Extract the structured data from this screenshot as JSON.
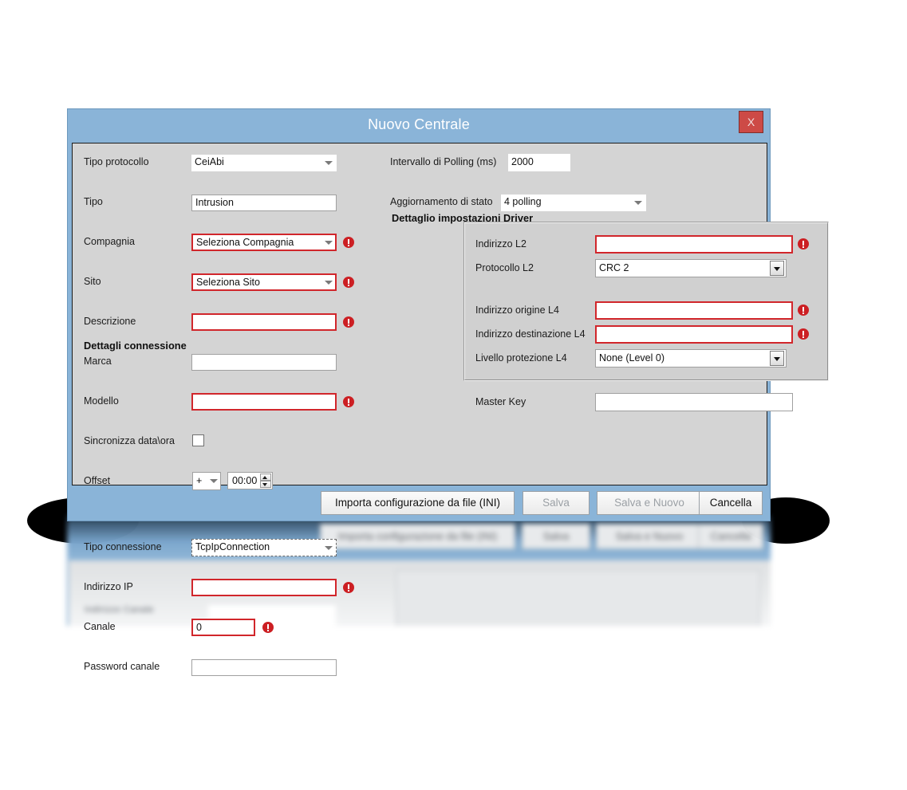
{
  "dialog": {
    "title": "Nuovo Centrale",
    "close_label": "X",
    "accent_blue": "#8ab4d8",
    "close_red": "#cd4a46",
    "error_red": "#cc1f23"
  },
  "left_column": {
    "rows": [
      {
        "label": "Tipo protocollo",
        "value": "CeiAbi",
        "control": "combo-flat",
        "error": false
      },
      {
        "label": "Tipo",
        "value": "Intrusion",
        "control": "textbox",
        "error": false
      },
      {
        "label": "Compagnia",
        "value": "Seleziona Compagnia",
        "control": "combo-flat",
        "error": true
      },
      {
        "label": "Sito",
        "value": "Seleziona Sito",
        "control": "combo-flat",
        "error": true
      },
      {
        "label": "Descrizione",
        "value": "",
        "control": "textbox",
        "error": true
      },
      {
        "label": "Marca",
        "value": "",
        "control": "textbox",
        "error": false
      },
      {
        "label": "Modello",
        "value": "",
        "control": "textbox",
        "error": true
      },
      {
        "label": "Sincronizza data\\ora",
        "value": "",
        "control": "checkbox",
        "error": false
      },
      {
        "label": "Offset",
        "value": "00:00",
        "control": "spinner",
        "error": false,
        "sign": "+"
      }
    ]
  },
  "connection_section": {
    "title": "Dettagli connessione",
    "rows": [
      {
        "label": "Tipo connessione",
        "value": "TcpIpConnection",
        "control": "combo-dashed",
        "error": false
      },
      {
        "label": "Indirizzo IP",
        "value": "",
        "control": "textbox",
        "error": true
      },
      {
        "label": "Canale",
        "value": "0",
        "control": "textbox",
        "error": true
      },
      {
        "label": "Password canale",
        "value": "",
        "control": "textbox",
        "error": false
      }
    ]
  },
  "right_column": {
    "rows": [
      {
        "label": "Intervallo di Polling (ms)",
        "value": "2000",
        "control": "textbox-flat",
        "error": false
      },
      {
        "label": "Aggiornamento di stato",
        "value": "4 polling",
        "control": "combo-flat",
        "error": false
      }
    ]
  },
  "driver_section": {
    "title": "Dettaglio impostazioni Driver",
    "rows": [
      {
        "label": "Indirizzo L2",
        "value": "",
        "control": "textbox",
        "error": true
      },
      {
        "label": "Protocollo L2",
        "value": "CRC 2",
        "control": "combo",
        "error": false
      },
      {
        "label": "Indirizzo origine L4",
        "value": "",
        "control": "textbox",
        "error": true
      },
      {
        "label": "Indirizzo destinazione L4",
        "value": "",
        "control": "textbox",
        "error": true
      },
      {
        "label": "Livello protezione L4",
        "value": "None (Level 0)",
        "control": "combo",
        "error": false
      },
      {
        "label": "Master Key",
        "value": "",
        "control": "textbox",
        "error": false
      }
    ]
  },
  "footer": {
    "buttons": [
      {
        "label": "Importa configurazione da file (INI)",
        "disabled": false
      },
      {
        "label": "Salva",
        "disabled": true
      },
      {
        "label": "Salva e Nuovo",
        "disabled": true
      },
      {
        "label": "Cancella",
        "disabled": false
      }
    ]
  },
  "artifact": {
    "blur_text": "Importa configurazione da file (INI)",
    "buttons": [
      {
        "label": "Importa configurazione da file (INI)"
      },
      {
        "label": "Salva"
      },
      {
        "label": "Salva e Nuovo"
      },
      {
        "label": "Cancella"
      }
    ]
  }
}
